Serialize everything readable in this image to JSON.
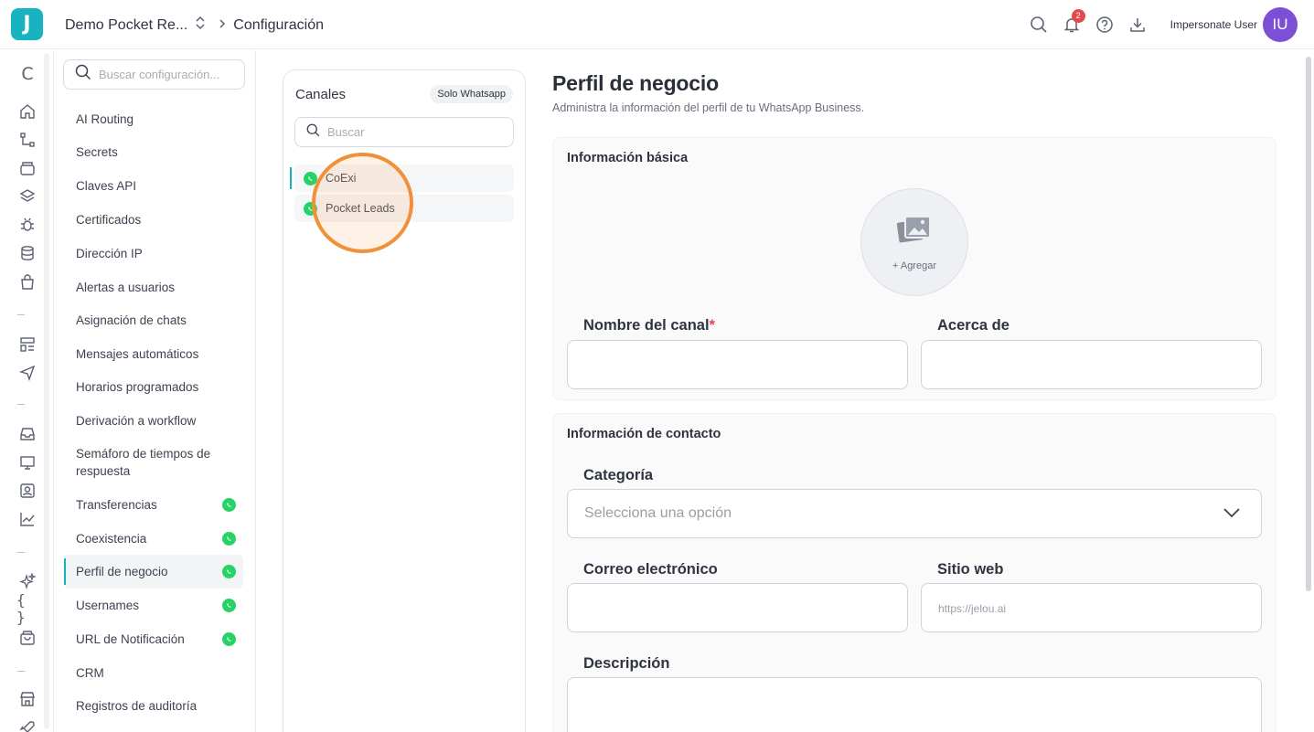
{
  "topbar": {
    "logo_letter": "J",
    "workspace": "Demo Pocket Re...",
    "breadcrumb": "Configuración",
    "notifications_count": "2",
    "user_name": "Impersonate User",
    "avatar_initials": "IU"
  },
  "rail": {
    "first_label": "C",
    "icons": [
      "home-icon",
      "flow-icon",
      "archive-icon",
      "layers-icon",
      "bug-icon",
      "database-icon",
      "bag-icon",
      "template-icon",
      "send-icon",
      "inbox-icon",
      "monitor-icon",
      "contact-icon",
      "chart-icon",
      "sparkles-icon",
      "braces-icon",
      "store-bag-icon",
      "store-icon",
      "rocket-icon"
    ]
  },
  "settings_nav": {
    "search_placeholder": "Buscar configuración...",
    "items": [
      {
        "label": "AI Routing",
        "whatsapp": false,
        "active": false
      },
      {
        "label": "Secrets",
        "whatsapp": false,
        "active": false
      },
      {
        "label": "Claves API",
        "whatsapp": false,
        "active": false
      },
      {
        "label": "Certificados",
        "whatsapp": false,
        "active": false
      },
      {
        "label": "Dirección IP",
        "whatsapp": false,
        "active": false
      },
      {
        "label": "Alertas a usuarios",
        "whatsapp": false,
        "active": false
      },
      {
        "label": "Asignación de chats",
        "whatsapp": false,
        "active": false
      },
      {
        "label": "Mensajes automáticos",
        "whatsapp": false,
        "active": false
      },
      {
        "label": "Horarios programados",
        "whatsapp": false,
        "active": false
      },
      {
        "label": "Derivación a workflow",
        "whatsapp": false,
        "active": false
      },
      {
        "label": "Semáforo de tiempos de respuesta",
        "whatsapp": false,
        "active": false
      },
      {
        "label": "Transferencias",
        "whatsapp": true,
        "active": false
      },
      {
        "label": "Coexistencia",
        "whatsapp": true,
        "active": false
      },
      {
        "label": "Perfil de negocio",
        "whatsapp": true,
        "active": true
      },
      {
        "label": "Usernames",
        "whatsapp": true,
        "active": false
      },
      {
        "label": "URL de Notificación",
        "whatsapp": true,
        "active": false
      },
      {
        "label": "CRM",
        "whatsapp": false,
        "active": false
      },
      {
        "label": "Registros de auditoría",
        "whatsapp": false,
        "active": false
      }
    ]
  },
  "channels": {
    "title": "Canales",
    "filter_chip": "Solo Whatsapp",
    "search_placeholder": "Buscar",
    "items": [
      {
        "label": "CoExi",
        "active": true
      },
      {
        "label": "Pocket Leads",
        "active": false
      }
    ]
  },
  "profile": {
    "title": "Perfil de negocio",
    "subtitle": "Administra la información del perfil de tu WhatsApp Business.",
    "basic": {
      "title": "Información básica",
      "photo_label": "+ Agregar",
      "name_label": "Nombre del canal",
      "name_required": "*",
      "name_value": "",
      "about_label": "Acerca de",
      "about_value": ""
    },
    "contact": {
      "title": "Información de contacto",
      "category_label": "Categoría",
      "category_placeholder": "Selecciona una opción",
      "email_label": "Correo electrónico",
      "email_value": "",
      "website_label": "Sitio web",
      "website_placeholder": "https://jelou.ai",
      "description_label": "Descripción"
    }
  },
  "colors": {
    "accent": "#17b3c1",
    "whatsapp": "#25d366",
    "avatar": "#7b4fd6",
    "badge": "#e5484d",
    "highlight": "#f0913a"
  }
}
